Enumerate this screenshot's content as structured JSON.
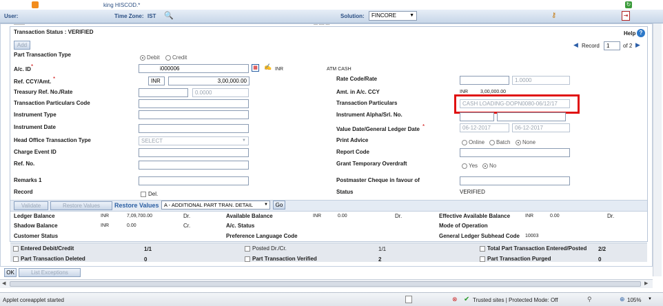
{
  "topbar": {
    "user_label": "User:",
    "user_name": "king HISCOD.*",
    "timezone_label": "Time Zone:",
    "timezone_value": "IST",
    "solution_label": "Solution:",
    "solution_value": "FINCORE"
  },
  "header": {
    "status": "Transaction Status : VERIFIED",
    "help": "Help",
    "record_label": "Record",
    "record_value": "1",
    "record_of": "of 2",
    "cut_text_left": "--------",
    "cut_text_mid": "--- ---- ---"
  },
  "form": {
    "part_tran_type_label": "Part Transaction Type",
    "debit": "Debit",
    "credit": "Credit",
    "add": "Add",
    "ac_id_label": "A/c. ID",
    "ac_id_value": "i000006",
    "ac_ccy": "INR",
    "ac_name": "ATM CASH",
    "ref_ccy_label": "Ref. CCY/Amt.",
    "ref_ccy": "INR",
    "ref_amt": "3,00,000.00",
    "rate_code_label": "Rate Code/Rate",
    "rate_value": "1.0000",
    "treasury_label": "Treasury Ref. No./Rate",
    "treasury_rate": "0.0000",
    "amt_ccy_label": "Amt. in A/c. CCY",
    "amt_ccy_ccy": "INR",
    "amt_ccy_value": "3,00,000.00",
    "tpc_label": "Transaction Particulars Code",
    "tp_label": "Transaction Particulars",
    "tp_value": "CASH LOADING-DOPN0080-06/12/17",
    "instr_type_label": "Instrument Type",
    "instr_alpha_label": "Instrument Alpha/Srl. No.",
    "instr_date_label": "Instrument Date",
    "value_date_label": "Value Date/General Ledger Date",
    "value_date": "06-12-2017",
    "gl_date": "06-12-2017",
    "ho_label": "Head Office Transaction Type",
    "ho_value": "SELECT",
    "print_advice_label": "Print Advice",
    "online": "Online",
    "batch": "Batch",
    "none": "None",
    "charge_label": "Charge Event ID",
    "report_code_label": "Report Code",
    "refno_label": "Ref. No.",
    "grant_label": "Grant Temporary Overdraft",
    "yes": "Yes",
    "no": "No",
    "remarks_label": "Remarks 1",
    "postmaster_label": "Postmaster Cheque in favour of",
    "record_label": "Record",
    "del": "Del.",
    "status_label": "Status",
    "status_value": "VERIFIED"
  },
  "actions": {
    "validate": "Validate",
    "restore": "Restore Values",
    "restore_link": "Restore Values",
    "select_value": "A - ADDITIONAL PART TRAN. DETAIL",
    "go": "Go"
  },
  "balances": {
    "ledger_label": "Ledger Balance",
    "ledger_ccy": "INR",
    "ledger_value": "7,09,700.00",
    "ledger_drcr": "Dr.",
    "avail_label": "Available Balance",
    "avail_ccy": "INR",
    "avail_value": "0.00",
    "avail_drcr": "Dr.",
    "eff_label": "Effective Available Balance",
    "eff_ccy": "INR",
    "eff_value": "0.00",
    "eff_drcr": "Dr.",
    "shadow_label": "Shadow Balance",
    "shadow_ccy": "INR",
    "shadow_value": "0.00",
    "shadow_drcr": "Cr.",
    "acstatus_label": "A/c. Status",
    "mode_label": "Mode of Operation",
    "cust_label": "Customer Status",
    "pref_label": "Preference Language Code",
    "gl_sub_label": "General Ledger Subhead Code",
    "gl_sub_value": "10003"
  },
  "summary": {
    "entered_label": "Entered Debit/Credit",
    "entered_value": "1/1",
    "posted_label": "Posted Dr./Cr.",
    "posted_value": "1/1",
    "total_label": "Total Part Transaction Entered/Posted",
    "total_value": "2/2",
    "deleted_label": "Part Transaction Deleted",
    "deleted_value": "0",
    "verified_label": "Part Transaction Verified",
    "verified_value": "2",
    "purged_label": "Part Transaction Purged",
    "purged_value": "0"
  },
  "footer": {
    "ok": "OK",
    "list_exceptions": "List Exceptions",
    "applet": "Applet coreapplet started",
    "zone": "Trusted sites | Protected Mode: Off",
    "zoom": "105%"
  }
}
